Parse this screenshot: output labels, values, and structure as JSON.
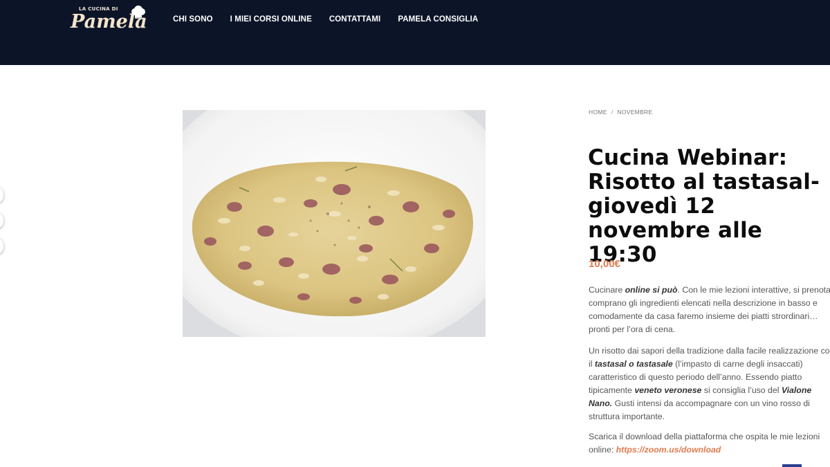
{
  "logo": {
    "small_text": "LA CUCINA DI",
    "main_text": "Pamela"
  },
  "nav": {
    "items": [
      "CHI SONO",
      "I MIEI CORSI ONLINE",
      "CONTATTAMI",
      "PAMELA CONSIGLIA"
    ]
  },
  "breadcrumb": {
    "home": "HOME",
    "separator": "/",
    "current": "NOVEMBRE"
  },
  "product": {
    "title": "Cucina Webinar: Risotto al tastasal- giovedì 12 novembre alle 19:30",
    "price": "10,00€",
    "description": {
      "p1": {
        "l1_a": "Cucinare ",
        "l1_b": "online si può",
        "l1_c": ". Con le mie lezioni interattive, si prenota,",
        "l2": "comprano gli ingredienti elencati nella descrizione in basso e",
        "l3": "comodamente da casa faremo insieme dei piatti strordinari…",
        "l4": "pronti per l’ora di cena."
      },
      "p2": {
        "l1": "Un risotto dai sapori della tradizione dalla facile realizzazione con",
        "l2_a": "il ",
        "l2_b": "tastasal o tastasale",
        "l2_c": " (l’impasto di carne degli insaccati)",
        "l3": "caratteristico di questo periodo dell’anno. Essendo piatto",
        "l4_a": "tipicamente ",
        "l4_b": "veneto veronese",
        "l4_c": " si consiglia l’uso del ",
        "l4_d": "Vialone",
        "l5_a": "Nano.",
        "l5_b": " Gusti intensi da accompagnare con un vino rosso di",
        "l6": "struttura importante."
      },
      "p3": {
        "l1": "Scarica il download della piattaforma che ospita le mie lezioni",
        "l2_a": "online: ",
        "l2_link": "https://zoom.us/download"
      }
    }
  },
  "colors": {
    "header_bg": "#0c1528",
    "accent": "#e07b4f",
    "title": "#0c0c0c"
  }
}
